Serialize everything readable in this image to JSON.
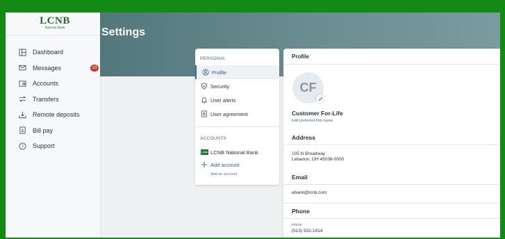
{
  "brand": {
    "name": "LCNB",
    "subtitle": "National Bank"
  },
  "sidebar": {
    "items": [
      {
        "label": "Dashboard",
        "icon": "dashboard-icon"
      },
      {
        "label": "Messages",
        "icon": "mail-icon",
        "badge": "33"
      },
      {
        "label": "Accounts",
        "icon": "accounts-icon"
      },
      {
        "label": "Transfers",
        "icon": "transfer-icon"
      },
      {
        "label": "Remote deposits",
        "icon": "deposit-icon"
      },
      {
        "label": "Bill pay",
        "icon": "bill-icon"
      },
      {
        "label": "Support",
        "icon": "help-icon"
      }
    ]
  },
  "header": {
    "title": "Settings"
  },
  "settings_menu": {
    "personal_heading": "PERSONAL",
    "items": [
      {
        "label": "Profile",
        "icon": "user-icon",
        "active": true
      },
      {
        "label": "Security",
        "icon": "shield-icon"
      },
      {
        "label": "User alerts",
        "icon": "bell-icon"
      },
      {
        "label": "User agreement",
        "icon": "document-icon"
      }
    ],
    "accounts_heading": "ACCOUNTS",
    "bank_name": "LCNB National Bank",
    "bank_logo_text": "LCNB",
    "add_account": "Add account",
    "add_account_sub": "Add an account"
  },
  "profile": {
    "title": "Profile",
    "initials": "CF",
    "name": "Customer For-Life",
    "edit_name_link": "Edit preferred first name",
    "address_title": "Address",
    "address_line1": "105 N Broadway",
    "address_line2": "Lebanon, OH 45036-0000",
    "email_title": "Email",
    "email": "ebank@lcnb.com",
    "phone_title": "Phone",
    "phone_label": "Home",
    "phone": "(513) 932-1414"
  },
  "colors": {
    "accent": "#3a6f95",
    "brand_green": "#1f6e2e",
    "badge": "#c8382e",
    "frame": "#138a13"
  }
}
